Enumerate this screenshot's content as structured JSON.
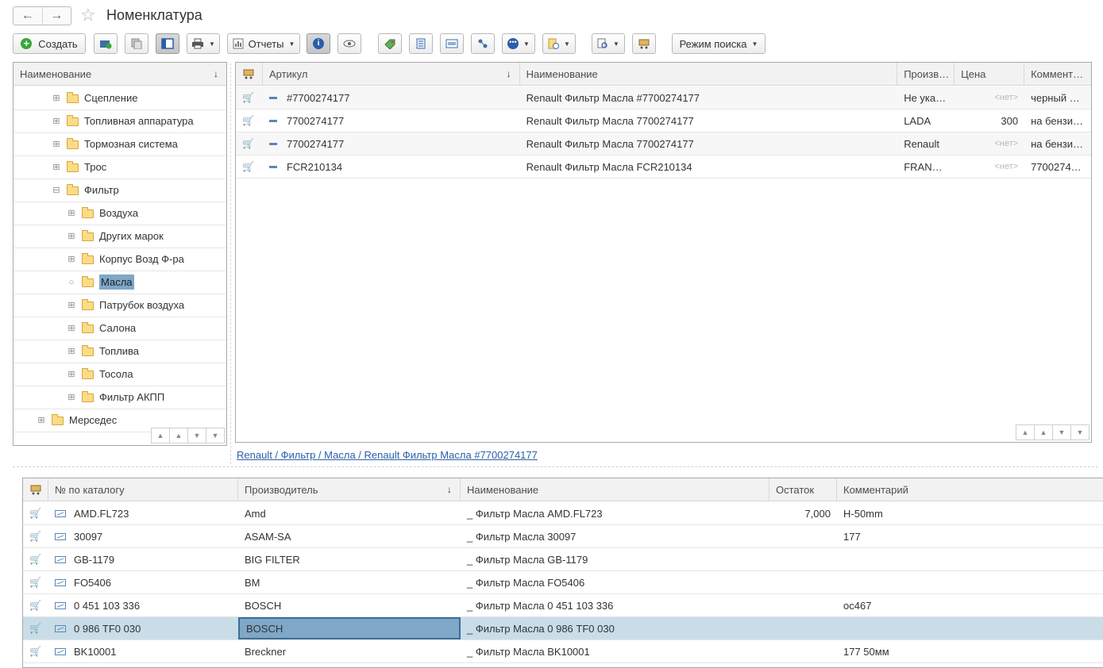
{
  "window": {
    "title": "Номенклатура"
  },
  "toolbar": {
    "create_label": "Создать",
    "reports_label": "Отчеты",
    "search_mode_label": "Режим поиска"
  },
  "tree": {
    "header": "Наименование",
    "items": [
      {
        "label": "Сцепление",
        "level": 2,
        "state": "plus"
      },
      {
        "label": "Топливная аппаратура",
        "level": 2,
        "state": "plus"
      },
      {
        "label": "Тормозная система",
        "level": 2,
        "state": "plus"
      },
      {
        "label": "Трос",
        "level": 2,
        "state": "plus"
      },
      {
        "label": "Фильтр",
        "level": 2,
        "state": "minus"
      },
      {
        "label": "Воздуха",
        "level": 3,
        "state": "plus"
      },
      {
        "label": "Других марок",
        "level": 3,
        "state": "plus"
      },
      {
        "label": "Корпус Возд Ф-ра",
        "level": 3,
        "state": "plus"
      },
      {
        "label": "Масла",
        "level": 3,
        "state": "leaf",
        "selected": true
      },
      {
        "label": "Патрубок воздуха",
        "level": 3,
        "state": "plus"
      },
      {
        "label": "Салона",
        "level": 3,
        "state": "plus"
      },
      {
        "label": "Топлива",
        "level": 3,
        "state": "plus"
      },
      {
        "label": "Тосола",
        "level": 3,
        "state": "plus"
      },
      {
        "label": "Фильтр АКПП",
        "level": 3,
        "state": "plus"
      },
      {
        "label": "Мерседес",
        "level": 1,
        "state": "plus"
      }
    ]
  },
  "items_table": {
    "headers": {
      "article": "Артикул",
      "name": "Наименование",
      "manufacturer": "Произв…",
      "price": "Цена",
      "comment": "Коммент…"
    },
    "rows": [
      {
        "article": "#7700274177",
        "name": "Renault Фильтр Масла #7700274177",
        "manufacturer": "Не ука…",
        "price": "<нет>",
        "comment": "черный …"
      },
      {
        "article": "7700274177",
        "name": "Renault Фильтр Масла 7700274177",
        "manufacturer": "LADA",
        "price": "300",
        "comment": "на бензи…"
      },
      {
        "article": "7700274177",
        "name": "Renault Фильтр Масла 7700274177",
        "manufacturer": "Renault",
        "price": "<нет>",
        "comment": "на бензи…"
      },
      {
        "article": "FCR210134",
        "name": "Renault Фильтр Масла FCR210134",
        "manufacturer": "FRAN…",
        "price": "<нет>",
        "comment": "7700274…"
      }
    ]
  },
  "breadcrumb": "Renault / Фильтр / Масла / Renault Фильтр Масла #7700274177",
  "analogs_table": {
    "headers": {
      "catalog_no": "№ по каталогу",
      "manufacturer": "Производитель",
      "name": "Наименование",
      "stock": "Остаток",
      "comment": "Комментарий"
    },
    "rows": [
      {
        "catalog_no": "AMD.FL723",
        "manufacturer": "Amd",
        "name": "_ Фильтр Масла AMD.FL723",
        "stock": "7,000",
        "comment": "H-50mm"
      },
      {
        "catalog_no": "30097",
        "manufacturer": "ASAM-SA",
        "name": "_ Фильтр Масла 30097",
        "stock": "",
        "comment": "177"
      },
      {
        "catalog_no": "GB-1179",
        "manufacturer": "BIG FILTER",
        "name": "_ Фильтр Масла GB-1179",
        "stock": "",
        "comment": ""
      },
      {
        "catalog_no": "FO5406",
        "manufacturer": "BM",
        "name": "_ Фильтр Масла FO5406",
        "stock": "",
        "comment": ""
      },
      {
        "catalog_no": "0 451 103 336",
        "manufacturer": "BOSCH",
        "name": "_ Фильтр Масла 0 451 103 336",
        "stock": "",
        "comment": "ос467"
      },
      {
        "catalog_no": "0 986 TF0 030",
        "manufacturer": "BOSCH",
        "name": "_ Фильтр Масла 0 986 TF0 030",
        "stock": "",
        "comment": "",
        "selected": true
      },
      {
        "catalog_no": "BK10001",
        "manufacturer": "Breckner",
        "name": "_ Фильтр Масла BK10001",
        "stock": "",
        "comment": "177 50мм"
      }
    ]
  }
}
